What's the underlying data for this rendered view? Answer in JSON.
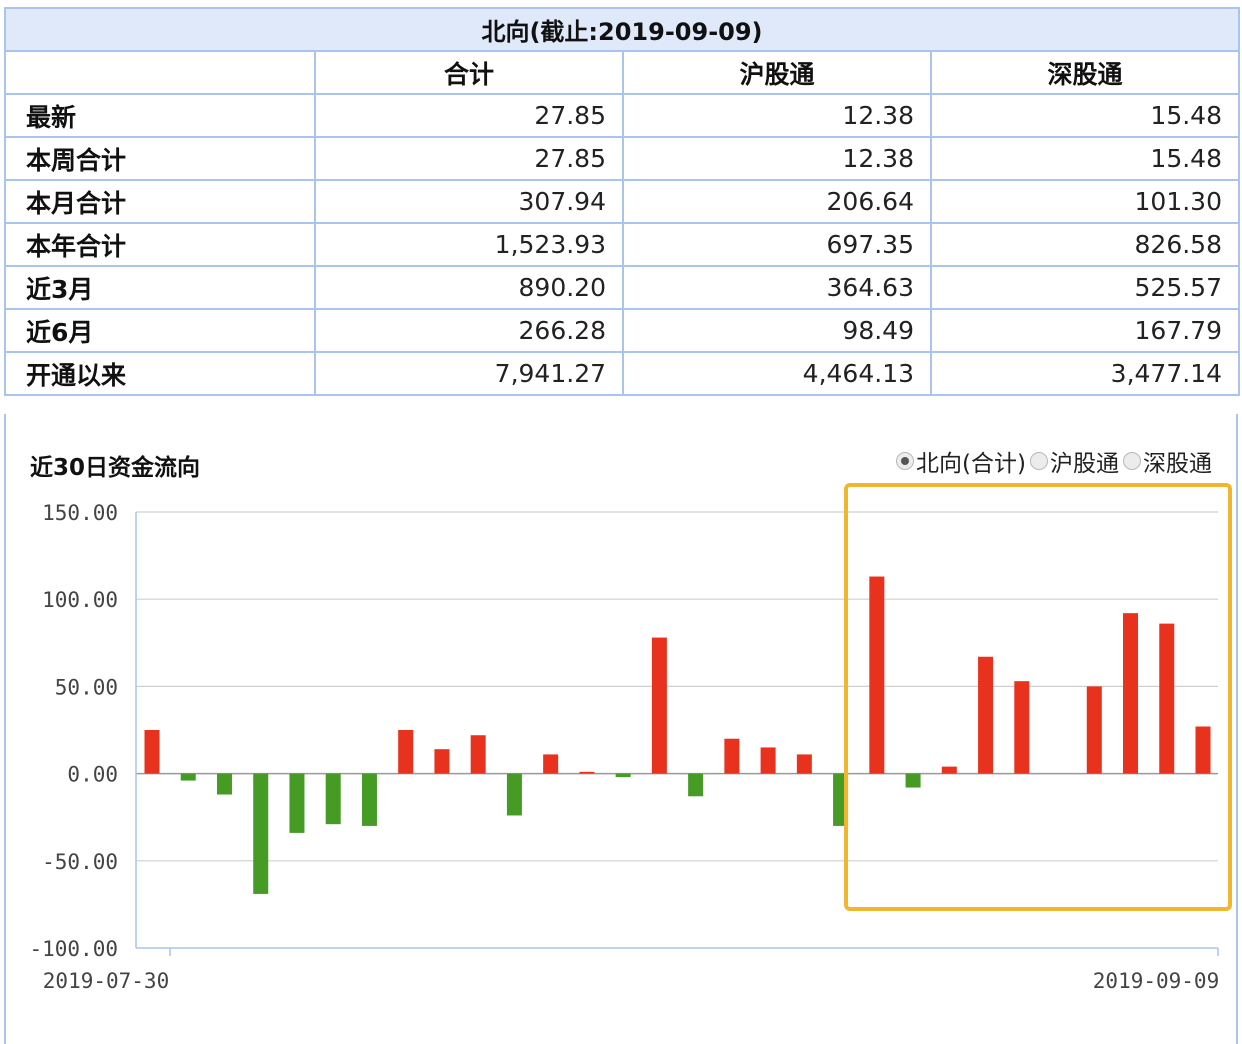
{
  "table": {
    "title": "北向(截止:2019-09-09)",
    "columns": [
      "",
      "合计",
      "沪股通",
      "深股通"
    ],
    "rows": [
      {
        "label": "最新",
        "values": [
          "27.85",
          "12.38",
          "15.48"
        ]
      },
      {
        "label": "本周合计",
        "values": [
          "27.85",
          "12.38",
          "15.48"
        ]
      },
      {
        "label": "本月合计",
        "values": [
          "307.94",
          "206.64",
          "101.30"
        ]
      },
      {
        "label": "本年合计",
        "values": [
          "1,523.93",
          "697.35",
          "826.58"
        ]
      },
      {
        "label": "近3月",
        "values": [
          "890.20",
          "364.63",
          "525.57"
        ]
      },
      {
        "label": "近6月",
        "values": [
          "266.28",
          "98.49",
          "167.79"
        ]
      },
      {
        "label": "开通以来",
        "values": [
          "7,941.27",
          "4,464.13",
          "3,477.14"
        ]
      }
    ]
  },
  "chart_panel": {
    "title": "近30日资金流向",
    "options": [
      {
        "label": "北向(合计)",
        "checked": true
      },
      {
        "label": "沪股通",
        "checked": false
      },
      {
        "label": "深股通",
        "checked": false
      }
    ]
  },
  "colors": {
    "positive": "#e8321e",
    "negative": "#469b25",
    "highlight": "#f2b530",
    "grid": "#cfcfcf",
    "axis": "#a9c4ee",
    "header_bg": "#dfe9fa"
  },
  "chart_data": {
    "type": "bar",
    "title": "",
    "ylim": [
      -100,
      150
    ],
    "y_ticks": [
      "150.00",
      "100.00",
      "50.00",
      "0.00",
      "-50.00",
      "-100.00"
    ],
    "y_tick_values": [
      150,
      100,
      50,
      0,
      -50,
      -100
    ],
    "x_start_label": "2019-07-30",
    "x_end_label": "2019-09-09",
    "values": [
      25,
      -4,
      -12,
      -69,
      -34,
      -29,
      -30,
      25,
      14,
      22,
      -24,
      11,
      1,
      -2,
      78,
      -13,
      20,
      15,
      11,
      -30,
      113,
      -8,
      4,
      67,
      53,
      0,
      50,
      92,
      86,
      27
    ],
    "grid": true,
    "highlight_box": "last 10 bars"
  }
}
